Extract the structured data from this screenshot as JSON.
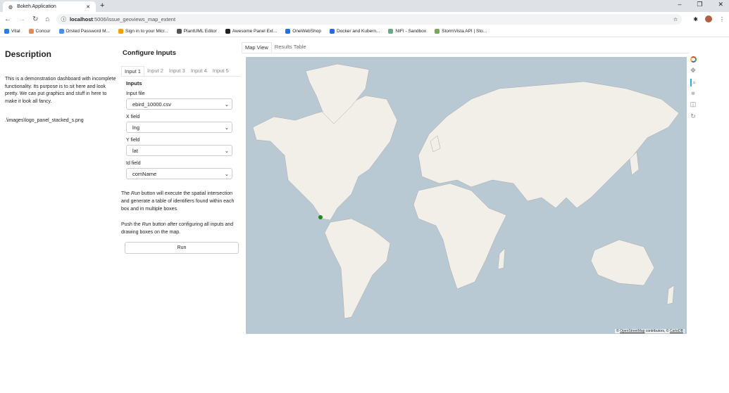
{
  "browser": {
    "tab_title": "Bokeh Application",
    "url_host": "localhost",
    "url_path": ":5006/issue_geoviews_map_extent",
    "bookmarks": [
      "Vital",
      "Concur",
      "Orsted Password M...",
      "Sign in to your Micr...",
      "PlantUML Editor",
      "Awesome Panel Ext...",
      "OneWebShop",
      "Docker and Kubern...",
      "NIFI - Sandbox",
      "StormVista API | Sto..."
    ]
  },
  "description": {
    "title": "Description",
    "text": "This is a demonstration dashboard with incomplete functionality. Its purpose is to sit here and look pretty. We can put graphics and stuff in here to make it look all fancy.",
    "image_path": ".\\images\\logo_panel_stacked_s.png"
  },
  "configure": {
    "title": "Configure Inputs",
    "tabs": [
      "Input 1",
      "Input 2",
      "Input 3",
      "Input 4",
      "Input 5"
    ],
    "active_tab": "Input 1",
    "section": "Inputs",
    "fields": [
      {
        "label": "Input file",
        "value": "ebird_10000.csv"
      },
      {
        "label": "X field",
        "value": "lng"
      },
      {
        "label": "Y field",
        "value": "lat"
      },
      {
        "label": "Id field",
        "value": "comName"
      }
    ],
    "para1_a": "The ",
    "para1_em": "Run",
    "para1_b": " button will execute the spatial intersection and generate a table of identifiers found within each box and in multiple boxes.",
    "para2_a": "Push the ",
    "para2_em": "Run",
    "para2_b": " button after configuring all inputs and drawing boxes on the map.",
    "run_label": "Run"
  },
  "map": {
    "tabs": [
      "Map View",
      "Results Table"
    ],
    "active_tab": "Map View",
    "attribution_a": "© ",
    "attribution_osm": "OpenStreetMap",
    "attribution_b": " contributors, © ",
    "attribution_carto": "CartoDB",
    "ocean_color": "#b8c9d3",
    "land_color": "#f2efe9",
    "point_color": "#1a8a1a",
    "tools": [
      "bokeh-logo",
      "pan",
      "box-zoom",
      "wheel-zoom",
      "box-edit",
      "reset"
    ]
  }
}
